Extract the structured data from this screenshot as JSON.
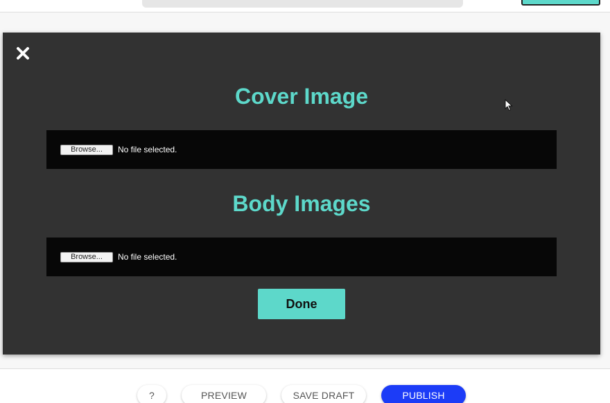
{
  "modal": {
    "cover_title": "Cover Image",
    "body_title": "Body Images",
    "cover_file": {
      "button_label": "Browse...",
      "status": "No file selected."
    },
    "body_file": {
      "button_label": "Browse...",
      "status": "No file selected."
    },
    "done_label": "Done",
    "close_icon": "close-icon"
  },
  "actions": {
    "help_label": "?",
    "preview_label": "PREVIEW",
    "save_draft_label": "SAVE DRAFT",
    "publish_label": "PUBLISH"
  },
  "colors": {
    "accent": "#5dd8ca",
    "modal_bg": "#323232",
    "panel_bg": "#070707",
    "publish": "#1c3cf7"
  }
}
